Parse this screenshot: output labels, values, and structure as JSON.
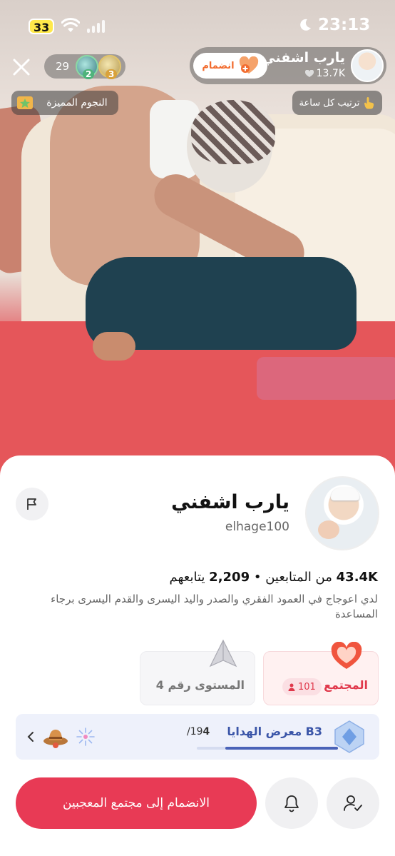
{
  "status_bar": {
    "battery": "33",
    "time": "23:13"
  },
  "live": {
    "viewer_count": "29",
    "top_viewers": [
      {
        "rank": "2"
      },
      {
        "rank": "3"
      }
    ],
    "host": {
      "name": "يارب اشفني",
      "likes": "13.7K",
      "join_label": "انضمام"
    },
    "featured_stars_label": "النجوم المميزة",
    "hourly_rank_label": "ترتيب كل ساعة"
  },
  "profile": {
    "name": "يارب اشفني",
    "handle": "elhage100",
    "followers_count": "43.4K",
    "followers_label": "من المتابعين",
    "following_count": "2,209",
    "following_label": "يتابعهم",
    "separator": "•",
    "bio": "لدي اعوجاج في العمود الفقري والصدر واليد اليسرى والقدم اليسرى برجاء المساعدة",
    "community": {
      "label": "المجتمع",
      "members": "101"
    },
    "level": {
      "label": "المستوى رقم 4"
    },
    "gift_gallery": {
      "title": "B3 معرض الهدايا",
      "progress_current": "4",
      "progress_total": "/19",
      "progress_fraction": 0.8
    },
    "join_fans_label": "الانضمام إلى مجتمع المعجبين"
  },
  "colors": {
    "accent": "#e83a55",
    "join_orange": "#f26b2e",
    "gift_blue": "#3a55a8"
  },
  "icons": [
    "close-icon",
    "wifi-icon",
    "signal-icon",
    "moon-icon",
    "heart-plus-icon",
    "like-heart-icon",
    "star-badge-icon",
    "hand-icon",
    "flag-icon",
    "person-icon",
    "heart-mascot-icon",
    "paper-plane-icon",
    "crystal-icon",
    "chevron-left-icon",
    "hat-gift-icon",
    "firework-gift-icon",
    "bell-icon",
    "person-check-icon"
  ]
}
